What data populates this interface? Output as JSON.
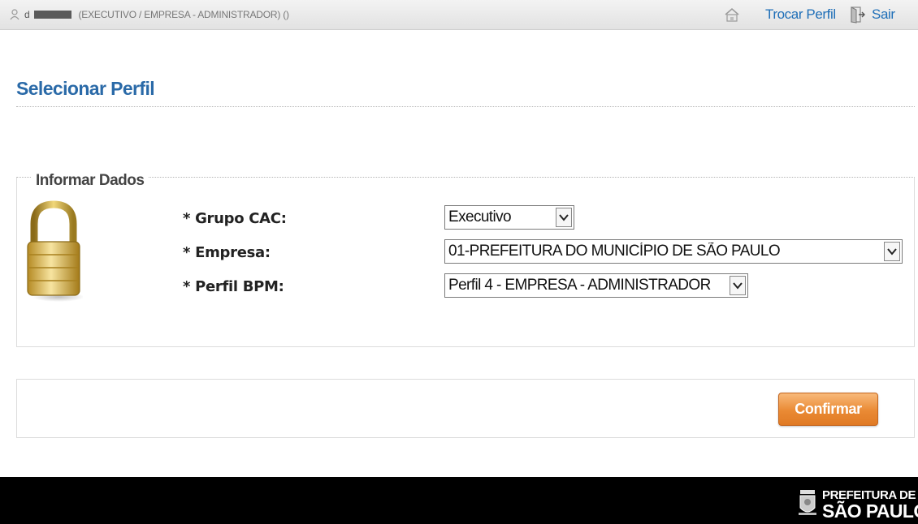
{
  "topbar": {
    "user_prefix": "d",
    "user_profile": "(EXECUTIVO / EMPRESA - ADMINISTRADOR) ()",
    "trocar_perfil": "Trocar Perfil",
    "sair": "Sair",
    "link_color": "#1f6fb8"
  },
  "page": {
    "title": "Selecionar Perfil"
  },
  "form": {
    "legend": "Informar Dados",
    "fields": [
      {
        "label": "* Grupo CAC:",
        "value": "Executivo"
      },
      {
        "label": "* Empresa:",
        "value": "01-PREFEITURA DO MUNICÍPIO DE SÃO PAULO"
      },
      {
        "label": "* Perfil BPM:",
        "value": "Perfil 4 - EMPRESA - ADMINISTRADOR"
      }
    ]
  },
  "actions": {
    "confirm": "Confirmar",
    "confirm_color": "#ea8a34"
  },
  "footer": {
    "logo_line1": "PREFEITURA DE",
    "logo_line2": "SÃO PAULO"
  },
  "icons": [
    "user-icon",
    "home-icon",
    "exit-door-icon",
    "padlock-icon",
    "chevron-down-icon",
    "city-seal-icon"
  ]
}
